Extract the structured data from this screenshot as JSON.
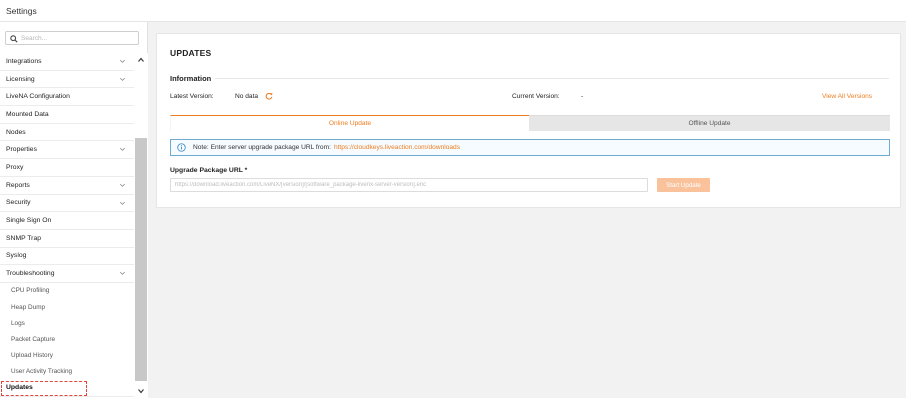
{
  "window": {
    "title": "Settings"
  },
  "search": {
    "placeholder": "Search..."
  },
  "sidebar": {
    "items": [
      {
        "label": "Integrations",
        "expandable": true
      },
      {
        "label": "Licensing",
        "expandable": true
      },
      {
        "label": "LiveNA Configuration",
        "expandable": false
      },
      {
        "label": "Mounted Data",
        "expandable": false
      },
      {
        "label": "Nodes",
        "expandable": false
      },
      {
        "label": "Properties",
        "expandable": true
      },
      {
        "label": "Proxy",
        "expandable": false
      },
      {
        "label": "Reports",
        "expandable": true
      },
      {
        "label": "Security",
        "expandable": true
      },
      {
        "label": "Single Sign On",
        "expandable": false
      },
      {
        "label": "SNMP Trap",
        "expandable": false
      },
      {
        "label": "Syslog",
        "expandable": false
      },
      {
        "label": "Troubleshooting",
        "expandable": true,
        "expanded": true
      },
      {
        "label": "CPU Profiling",
        "sub": true
      },
      {
        "label": "Heap Dump",
        "sub": true
      },
      {
        "label": "Logs",
        "sub": true
      },
      {
        "label": "Packet Capture",
        "sub": true
      },
      {
        "label": "Upload History",
        "sub": true
      },
      {
        "label": "User Activity Tracking",
        "sub": true
      },
      {
        "label": "Updates",
        "active": true
      }
    ]
  },
  "main": {
    "title": "UPDATES",
    "information": {
      "heading": "Information",
      "latest_label": "Latest Version:",
      "latest_value": "No data",
      "current_label": "Current Version:",
      "current_value": "-",
      "view_all_link": "View All Versions"
    },
    "tabs": [
      {
        "label": "Online Update",
        "active": true
      },
      {
        "label": "Offline Update",
        "active": false
      }
    ],
    "note": {
      "text": "Note: Enter server upgrade package URL from:",
      "link": "https://cloudkeys.liveaction.com/downloads"
    },
    "url_field": {
      "label": "Upgrade Package URL *",
      "value": "",
      "placeholder": "https://download.liveaction.com/LiveNX/[version]/[software_package-livenx-server-version].enc"
    },
    "start_button": "Start Update"
  },
  "colors": {
    "accent": "#ef7d1f",
    "button_disabled": "#f9c29b",
    "info_border": "#6ea9cf",
    "focus_outline": "#e0443a"
  }
}
